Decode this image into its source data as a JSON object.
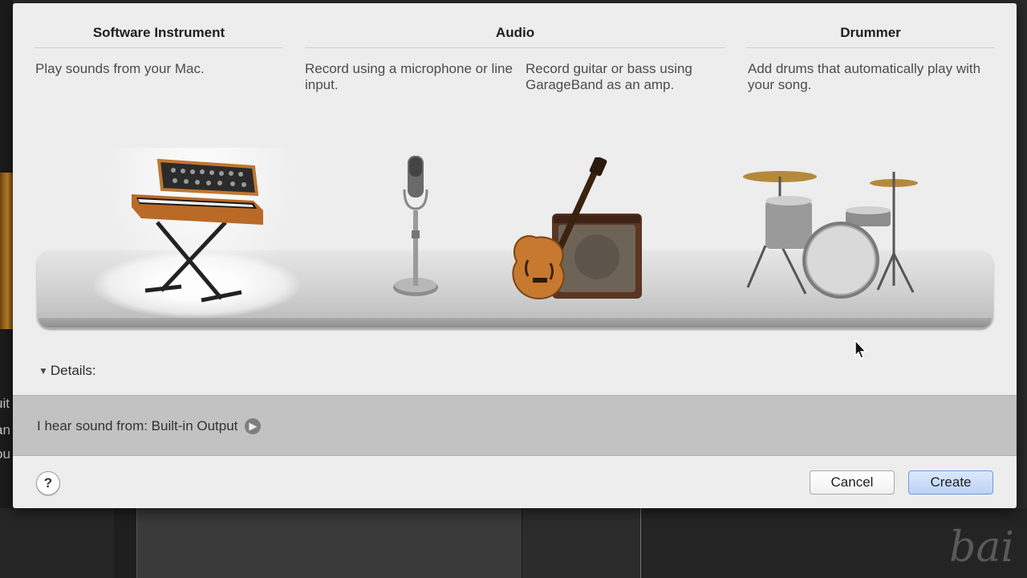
{
  "background": {
    "left_fragments": [
      "uit",
      "an",
      "ou"
    ],
    "watermark": "bai"
  },
  "dialog": {
    "columns": [
      {
        "heading": "Software Instrument"
      },
      {
        "heading": "Audio"
      },
      {
        "heading": "Drummer"
      }
    ],
    "instruments": [
      {
        "name": "Software Instrument",
        "description": "Play sounds from your Mac.",
        "icon": "synthesizer-icon",
        "selected": true
      },
      {
        "name": "Microphone",
        "description": "Record using a microphone or line input.",
        "icon": "microphone-icon",
        "selected": false
      },
      {
        "name": "Guitar",
        "description": "Record guitar or bass using GarageBand as an amp.",
        "icon": "guitar-amp-icon",
        "selected": false
      },
      {
        "name": "Drummer",
        "description": "Add drums that automatically play with your song.",
        "icon": "drum-kit-icon",
        "selected": false
      }
    ],
    "details_label": "Details:",
    "sound_output_label": "I hear sound from: Built-in Output",
    "help_label": "?",
    "cancel_label": "Cancel",
    "create_label": "Create"
  }
}
